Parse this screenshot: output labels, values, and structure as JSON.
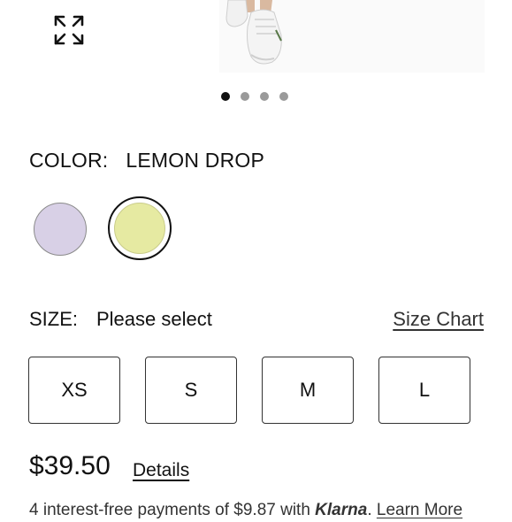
{
  "gallery": {
    "expand_icon": "expand-arrows-icon",
    "slide_count": 4,
    "active_slide": 1
  },
  "color": {
    "label": "COLOR:",
    "selected_value": "LEMON DROP",
    "swatches": [
      {
        "color": "#d8d0e6",
        "selected": false
      },
      {
        "color": "#e6eaa2",
        "selected": true
      }
    ]
  },
  "size": {
    "label": "SIZE:",
    "selected_value": "Please select",
    "chart_link": "Size Chart",
    "options": [
      "XS",
      "S",
      "M",
      "L"
    ]
  },
  "price": {
    "amount": "$39.50",
    "details_link": "Details"
  },
  "klarna": {
    "prefix": "4 interest-free payments of $9.87 with ",
    "brand": "Klarna",
    "separator": ". ",
    "learn_more": "Learn More"
  }
}
